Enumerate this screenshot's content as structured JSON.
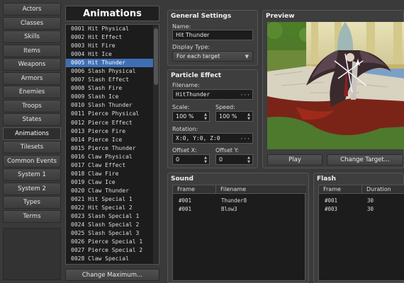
{
  "tabs": [
    {
      "label": "Actors",
      "active": false
    },
    {
      "label": "Classes",
      "active": false
    },
    {
      "label": "Skills",
      "active": false
    },
    {
      "label": "Items",
      "active": false
    },
    {
      "label": "Weapons",
      "active": false
    },
    {
      "label": "Armors",
      "active": false
    },
    {
      "label": "Enemies",
      "active": false
    },
    {
      "label": "Troops",
      "active": false
    },
    {
      "label": "States",
      "active": false
    },
    {
      "label": "Animations",
      "active": true
    },
    {
      "label": "Tilesets",
      "active": false
    },
    {
      "label": "Common Events",
      "active": false
    },
    {
      "label": "System 1",
      "active": false
    },
    {
      "label": "System 2",
      "active": false
    },
    {
      "label": "Types",
      "active": false
    },
    {
      "label": "Terms",
      "active": false
    }
  ],
  "animations": {
    "title": "Animations",
    "selected_index": 4,
    "items": [
      "0001 Hit Physical",
      "0002 Hit Effect",
      "0003 Hit Fire",
      "0004 Hit Ice",
      "0005 Hit Thunder",
      "0006 Slash Physical",
      "0007 Slash Effect",
      "0008 Slash Fire",
      "0009 Slash Ice",
      "0010 Slash Thunder",
      "0011 Pierce Physical",
      "0012 Pierce Effect",
      "0013 Pierce Fire",
      "0014 Pierce Ice",
      "0015 Pierce Thunder",
      "0016 Claw Physical",
      "0017 Claw Effect",
      "0018 Claw Fire",
      "0019 Claw Ice",
      "0020 Claw Thunder",
      "0021 Hit Special 1",
      "0022 Hit Special 2",
      "0023 Slash Special 1",
      "0024 Slash Special 2",
      "0025 Slash Special 3",
      "0026 Pierce Special 1",
      "0027 Pierce Special 2",
      "0028 Claw Special"
    ],
    "change_max_label": "Change Maximum..."
  },
  "general": {
    "title": "General Settings",
    "name_label": "Name:",
    "name_value": "Hit Thunder",
    "display_type_label": "Display Type:",
    "display_type_value": "For each target"
  },
  "particle": {
    "title": "Particle Effect",
    "filename_label": "Filename:",
    "filename_value": "HitThunder",
    "scale_label": "Scale:",
    "scale_value": "100 %",
    "speed_label": "Speed:",
    "speed_value": "100 %",
    "rotation_label": "Rotation:",
    "rotation_value": "X:0, Y:0, Z:0",
    "offset_x_label": "Offset X:",
    "offset_x_value": "0",
    "offset_y_label": "Offset Y:",
    "offset_y_value": "0"
  },
  "preview": {
    "title": "Preview",
    "play_label": "Play",
    "change_target_label": "Change Target..."
  },
  "sound": {
    "title": "Sound",
    "col_frame": "Frame",
    "col_filename": "Filename",
    "rows": [
      {
        "frame": "#001",
        "filename": "Thunder8"
      },
      {
        "frame": "#001",
        "filename": "Blow3"
      }
    ]
  },
  "flash": {
    "title": "Flash",
    "col_frame": "Frame",
    "col_duration": "Duration",
    "rows": [
      {
        "frame": "#001",
        "duration": "30"
      },
      {
        "frame": "#003",
        "duration": "30"
      }
    ]
  }
}
